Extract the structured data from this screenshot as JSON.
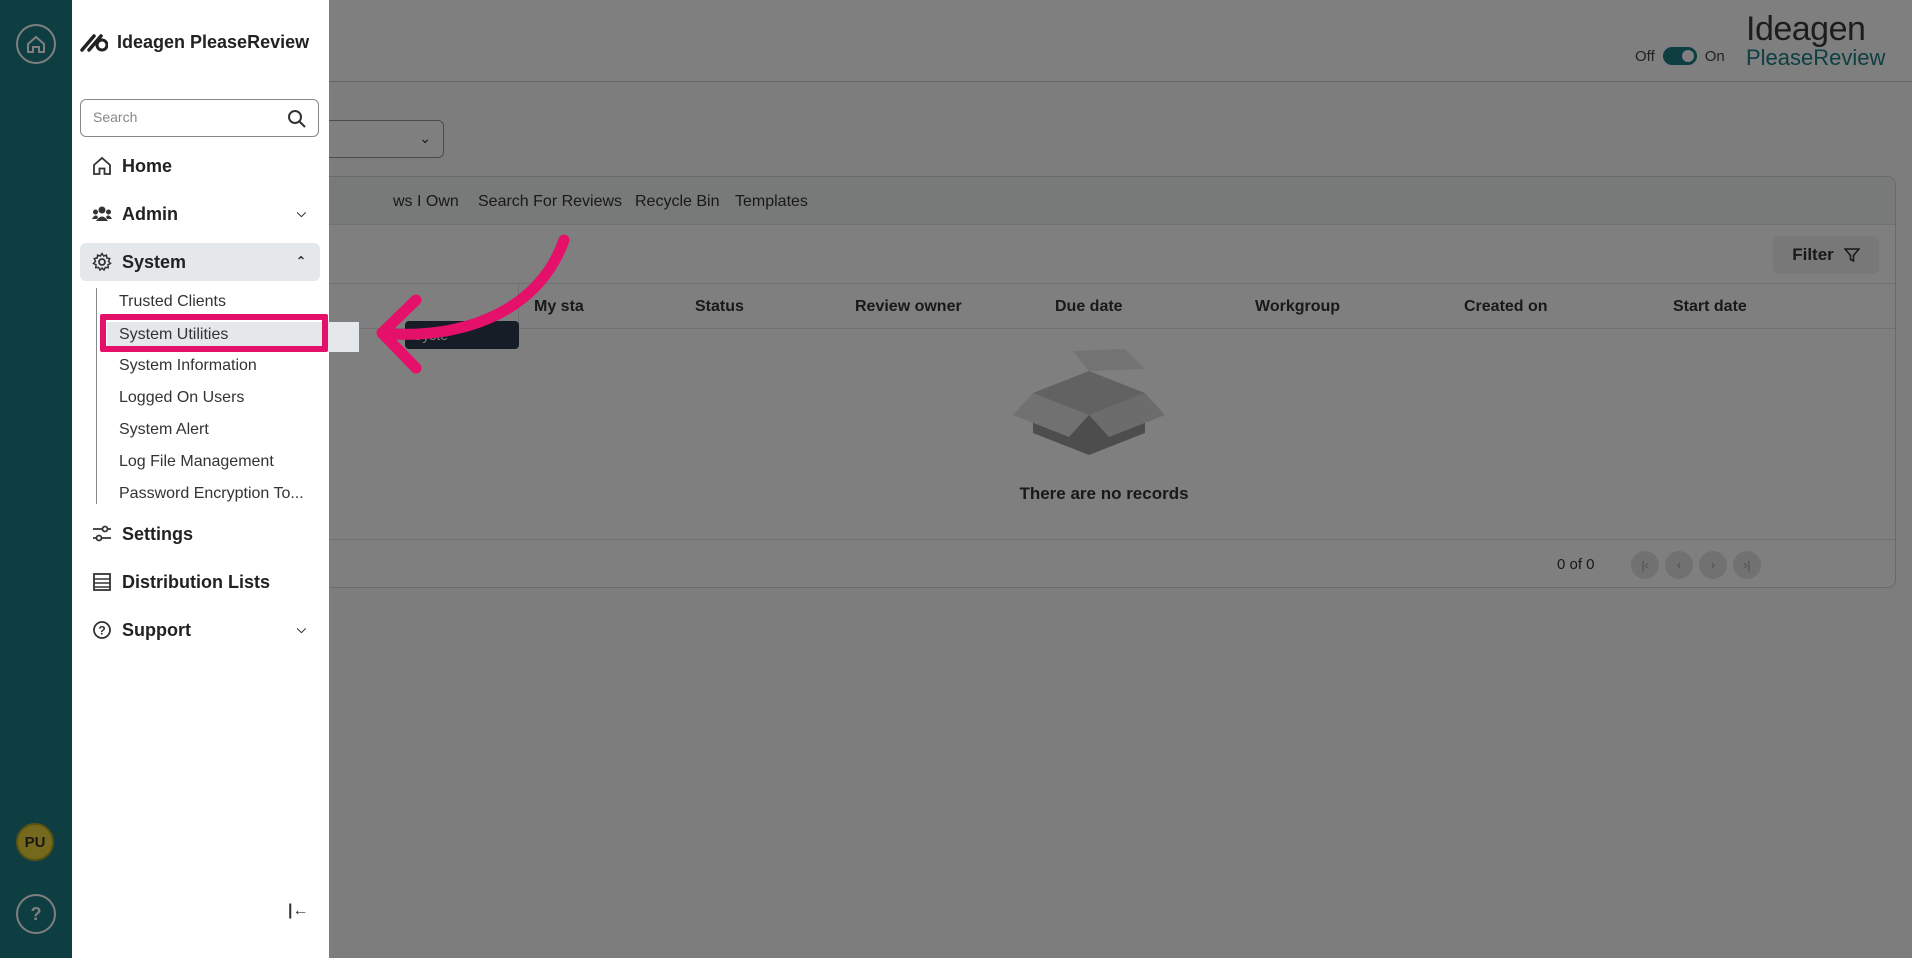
{
  "app": {
    "name": "Ideagen PleaseReview",
    "brand_top": "Ideagen",
    "brand_bottom": "PleaseReview"
  },
  "toggle": {
    "off_label": "Off",
    "on_label": "On",
    "state": "on"
  },
  "rail": {
    "avatar_initials": "PU",
    "help_label": "?"
  },
  "sidebar": {
    "search_placeholder": "Search",
    "nav": [
      {
        "label": "Home",
        "icon": "home-icon"
      },
      {
        "label": "Admin",
        "icon": "users-icon",
        "expandable": true,
        "expanded": false
      },
      {
        "label": "System",
        "icon": "gear-icon",
        "expandable": true,
        "expanded": true
      },
      {
        "label": "Settings",
        "icon": "sliders-icon"
      },
      {
        "label": "Distribution Lists",
        "icon": "list-icon"
      },
      {
        "label": "Support",
        "icon": "help-circle-icon",
        "expandable": true,
        "expanded": false
      }
    ],
    "system_sub": [
      "Trusted Clients",
      "System Utilities",
      "System Information",
      "Logged On Users",
      "System Alert",
      "Log File Management",
      "Password Encryption To..."
    ],
    "selected_sub": "System Utilities"
  },
  "tabs": [
    "ws I Own",
    "Search For Reviews",
    "Recycle Bin",
    "Templates"
  ],
  "filter_label": "Filter",
  "columns": [
    "My sta",
    "Status",
    "Review owner",
    "Due date",
    "Workgroup",
    "Created on",
    "Start date"
  ],
  "empty_text": "There are no records",
  "pager": {
    "text": "0 of 0"
  },
  "tooltip": "Syste",
  "colors": {
    "accent": "#1d7c85",
    "annotation": "#e5106a",
    "brand_mark": "#d12e6c"
  }
}
